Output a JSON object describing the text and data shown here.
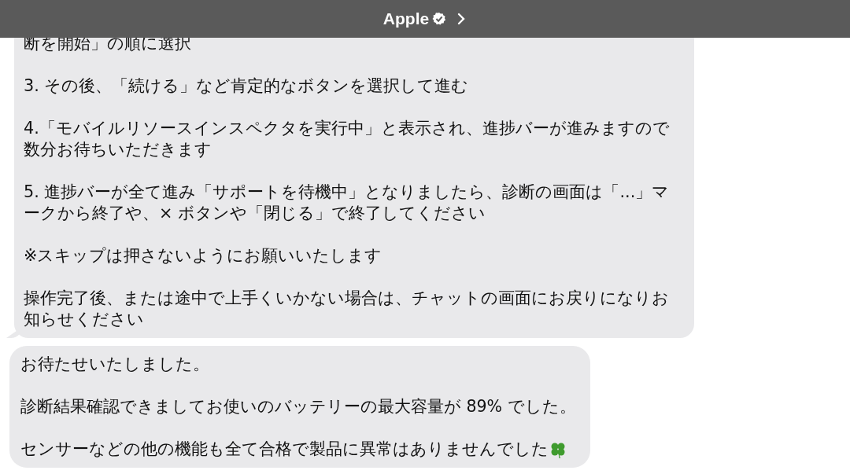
{
  "header": {
    "title": "Apple",
    "verified": true
  },
  "messages": [
    {
      "tail": true,
      "clover": false,
      "paragraphs": [
        "断を開始」の順に選択",
        "3. その後、「続ける」など肯定的なボタンを選択して進む",
        "4.「モバイルリソースインスペクタを実行中」と表示され、進捗バーが進みますので数分お待ちいただきます",
        "5. 進捗バーが全て進み「サポートを待機中」となりましたら、診断の画面は「...」マークから終了や、× ボタンや「閉じる」で終了してください",
        "※スキップは押さないようにお願いいたします",
        "操作完了後、または途中で上手くいかない場合は、チャットの画面にお戻りになりお知らせください"
      ]
    },
    {
      "tail": false,
      "clover": true,
      "paragraphs": [
        "お待たせいたしました。",
        "診断結果確認できましてお使いのバッテリーの最大容量が 89% でした。",
        "センサーなどの他の機能も全て合格で製品に異常はありませんでした"
      ]
    }
  ]
}
